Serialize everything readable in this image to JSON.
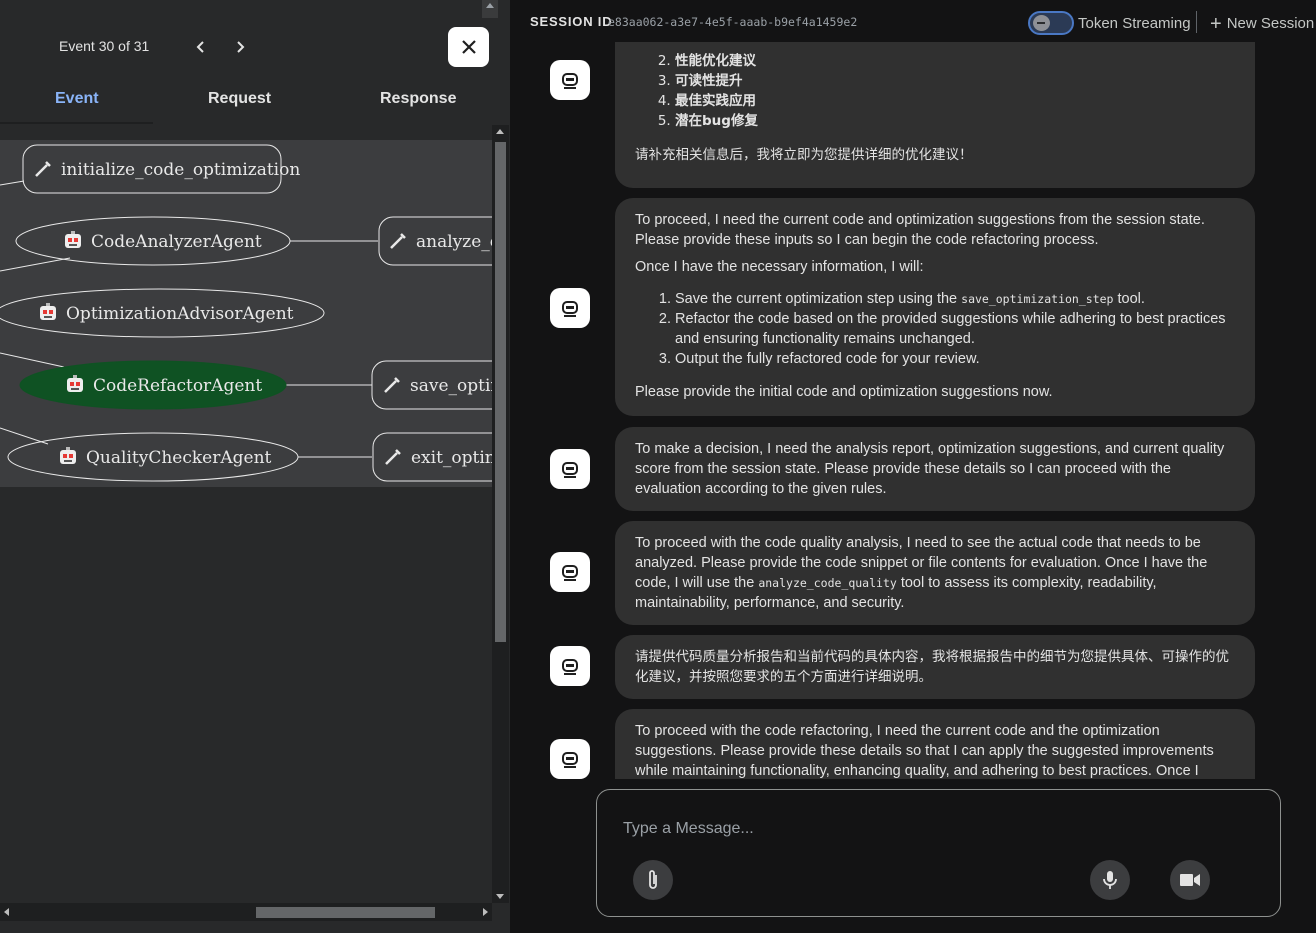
{
  "event_panel": {
    "event_counter": "Event 30 of 31",
    "tabs": [
      {
        "label": "Event",
        "active": true
      },
      {
        "label": "Request",
        "active": false
      },
      {
        "label": "Response",
        "active": false
      }
    ],
    "graph": {
      "nodes": [
        {
          "label": "initialize_code_optimization",
          "kind": "tool"
        },
        {
          "label": "CodeAnalyzerAgent",
          "kind": "agent"
        },
        {
          "label": "analyze_c",
          "kind": "tool"
        },
        {
          "label": "OptimizationAdvisorAgent",
          "kind": "agent"
        },
        {
          "label": "CodeRefactorAgent",
          "kind": "agent",
          "highlighted": true
        },
        {
          "label": "save_optim",
          "kind": "tool"
        },
        {
          "label": "QualityCheckerAgent",
          "kind": "agent"
        },
        {
          "label": "exit_optim",
          "kind": "tool"
        }
      ],
      "highlight_color": "#0f5223"
    }
  },
  "header": {
    "session_label": "SESSION ID",
    "session_id": "e83aa062-a3e7-4e5f-aaab-b9ef4a1459e2",
    "token_streaming_label": "Token Streaming",
    "token_streaming_enabled": false,
    "new_session_label": "New Session"
  },
  "messages": [
    {
      "list": [
        "性能优化建议",
        "可读性提升",
        "最佳实践应用",
        "潜在bug修复"
      ],
      "list_start": 2,
      "text": "请补充相关信息后，我将立即为您提供详细的优化建议！"
    },
    {
      "intro": "To proceed, I need the current code and optimization suggestions from the session state. Please provide these inputs so I can begin the code refactoring process.",
      "lead": "Once I have the necessary information, I will:",
      "item1_pre": "Save the current optimization step using the ",
      "item1_code": "save_optimization_step",
      "item1_post": " tool.",
      "item2": "Refactor the code based on the provided suggestions while adhering to best practices and ensuring functionality remains unchanged.",
      "item3": "Output the fully refactored code for your review.",
      "outro": "Please provide the initial code and optimization suggestions now."
    },
    {
      "text": "To make a decision, I need the analysis report, optimization suggestions, and current quality score from the session state. Please provide these details so I can proceed with the evaluation according to the given rules."
    },
    {
      "pre": "To proceed with the code quality analysis, I need to see the actual code that needs to be analyzed. Please provide the code snippet or file contents for evaluation. Once I have the code, I will use the ",
      "code": "analyze_code_quality",
      "post": " tool to assess its complexity, readability, maintainability, performance, and security."
    },
    {
      "text": "请提供代码质量分析报告和当前代码的具体内容，我将根据报告中的细节为您提供具体、可操作的优化建议，并按照您要求的五个方面进行详细说明。"
    },
    {
      "text": "To proceed with the code refactoring, I need the current code and the optimization suggestions. Please provide these details so that I can apply the suggested improvements while maintaining functionality, enhancing quality, and adhering to best practices. Once I"
    }
  ],
  "composer": {
    "placeholder": "Type a Message..."
  },
  "icons": {
    "close": "close-icon",
    "prev": "chevron-left-icon",
    "next": "chevron-right-icon",
    "tool": "wrench-icon",
    "agent": "robot-icon",
    "attach": "paperclip-icon",
    "mic": "microphone-icon",
    "video": "video-camera-icon",
    "avatar": "bot-icon"
  }
}
